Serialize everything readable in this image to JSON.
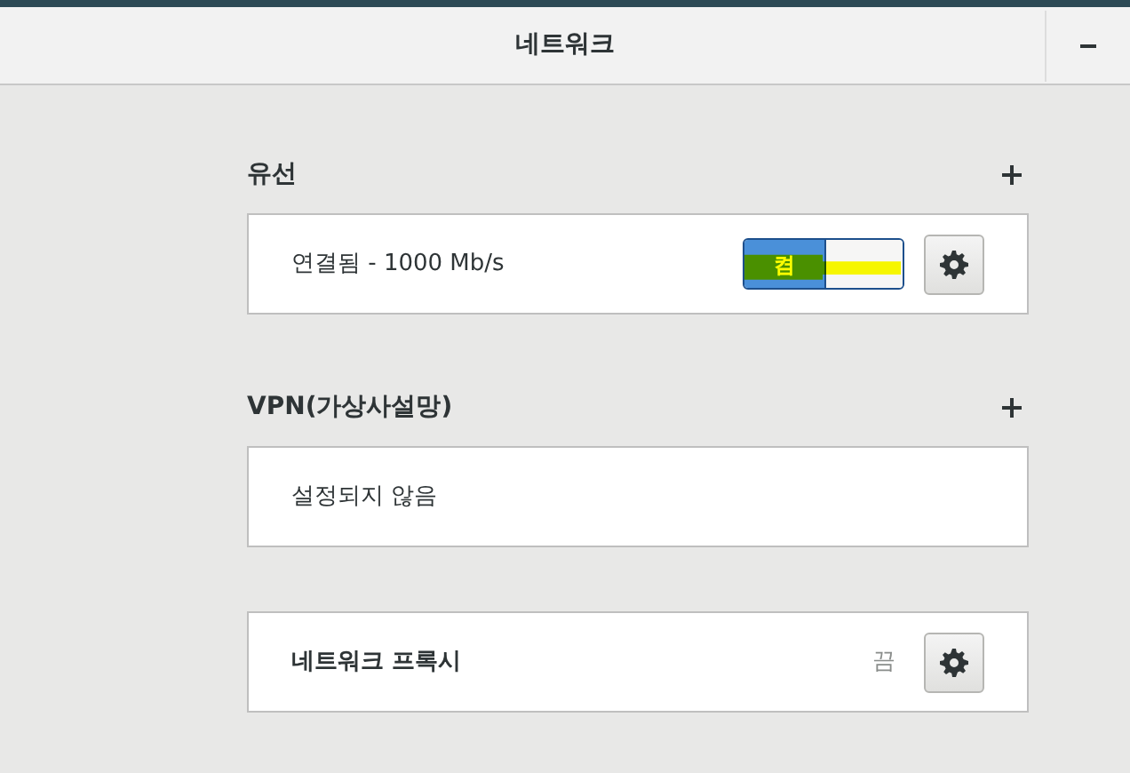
{
  "window": {
    "title": "네트워크",
    "minimize": true
  },
  "sections": [
    {
      "title": "유선",
      "add": true,
      "rows": [
        {
          "kind": "connection",
          "label": "연결됨 - 1000 Mb/s",
          "switch": {
            "label": "켬",
            "on": true,
            "highlighted": true
          },
          "settings": true
        }
      ]
    },
    {
      "title": "VPN(가상사설망)",
      "add": true,
      "rows": [
        {
          "kind": "empty",
          "label": "설정되지 않음"
        }
      ]
    },
    {
      "rows": [
        {
          "kind": "proxy",
          "label": "네트워크 프록시",
          "status": "끔",
          "settings": true
        }
      ]
    }
  ]
}
